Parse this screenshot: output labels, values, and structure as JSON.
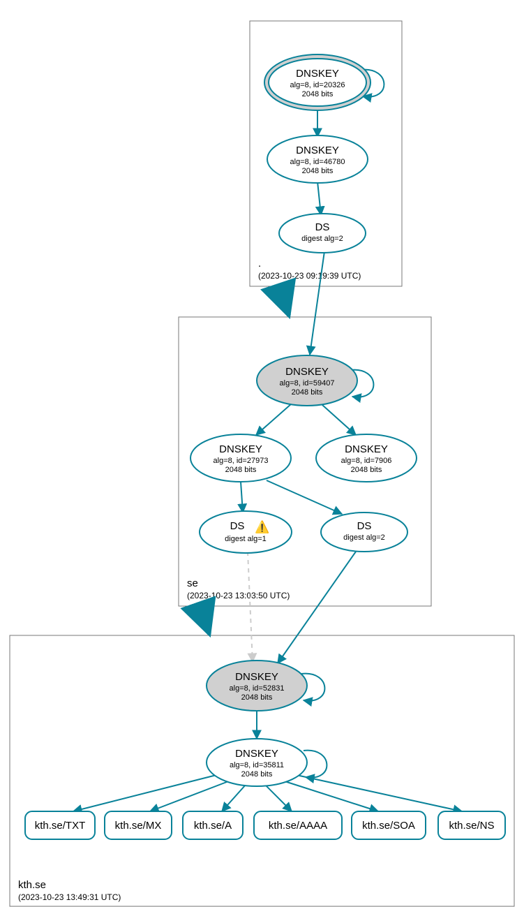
{
  "colors": {
    "accent": "#098299",
    "node_fill": "#d0d0d0",
    "warn_dash": "#cccccc"
  },
  "zones": {
    "root": {
      "name": ".",
      "time": "(2023-10-23 09:19:39 UTC)"
    },
    "se": {
      "name": "se",
      "time": "(2023-10-23 13:03:50 UTC)"
    },
    "kth": {
      "name": "kth.se",
      "time": "(2023-10-23 13:49:31 UTC)"
    }
  },
  "nodes": {
    "root_ksk": {
      "t": "DNSKEY",
      "l1": "alg=8, id=20326",
      "l2": "2048 bits"
    },
    "root_zsk": {
      "t": "DNSKEY",
      "l1": "alg=8, id=46780",
      "l2": "2048 bits"
    },
    "root_ds": {
      "t": "DS",
      "l1": "digest alg=2"
    },
    "se_ksk": {
      "t": "DNSKEY",
      "l1": "alg=8, id=59407",
      "l2": "2048 bits"
    },
    "se_zsk1": {
      "t": "DNSKEY",
      "l1": "alg=8, id=27973",
      "l2": "2048 bits"
    },
    "se_zsk2": {
      "t": "DNSKEY",
      "l1": "alg=8, id=7906",
      "l2": "2048 bits"
    },
    "se_ds1": {
      "t": "DS",
      "l1": "digest alg=1"
    },
    "se_ds2": {
      "t": "DS",
      "l1": "digest alg=2"
    },
    "kth_ksk": {
      "t": "DNSKEY",
      "l1": "alg=8, id=52831",
      "l2": "2048 bits"
    },
    "kth_zsk": {
      "t": "DNSKEY",
      "l1": "alg=8, id=35811",
      "l2": "2048 bits"
    }
  },
  "rrsets": [
    "kth.se/TXT",
    "kth.se/MX",
    "kth.se/A",
    "kth.se/AAAA",
    "kth.se/SOA",
    "kth.se/NS"
  ],
  "warning_icon": "⚠️"
}
